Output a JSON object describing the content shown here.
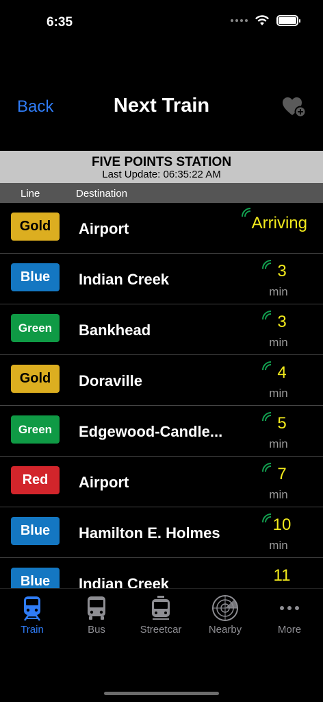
{
  "status_bar": {
    "time": "6:35"
  },
  "nav": {
    "back_label": "Back",
    "title": "Next Train"
  },
  "station": {
    "name": "FIVE POINTS STATION",
    "last_update": "Last Update: 06:35:22 AM"
  },
  "columns": {
    "line": "Line",
    "destination": "Destination"
  },
  "trains": [
    {
      "line": "Gold",
      "destination": "Airport",
      "eta": "Arriving",
      "unit": ""
    },
    {
      "line": "Blue",
      "destination": "Indian Creek",
      "eta": "3",
      "unit": "min"
    },
    {
      "line": "Green",
      "destination": "Bankhead",
      "eta": "3",
      "unit": "min"
    },
    {
      "line": "Gold",
      "destination": "Doraville",
      "eta": "4",
      "unit": "min"
    },
    {
      "line": "Green",
      "destination": "Edgewood-Candle...",
      "eta": "5",
      "unit": "min"
    },
    {
      "line": "Red",
      "destination": "Airport",
      "eta": "7",
      "unit": "min"
    },
    {
      "line": "Blue",
      "destination": "Hamilton E. Holmes",
      "eta": "10",
      "unit": "min"
    },
    {
      "line": "Blue",
      "destination": "Indian Creek",
      "eta": "11",
      "unit": ""
    }
  ],
  "tabs": [
    {
      "label": "Train",
      "icon": "train-icon",
      "active": true
    },
    {
      "label": "Bus",
      "icon": "bus-icon",
      "active": false
    },
    {
      "label": "Streetcar",
      "icon": "streetcar-icon",
      "active": false
    },
    {
      "label": "Nearby",
      "icon": "radar-icon",
      "active": false
    },
    {
      "label": "More",
      "icon": "more-dots-icon",
      "active": false
    }
  ],
  "colors": {
    "accent": "#2f7cf6",
    "eta": "#f2ea1c",
    "realtime": "#12a050",
    "gold": "#dcae20",
    "blue": "#1477c2",
    "green": "#0f9a45",
    "red": "#d2252b"
  }
}
